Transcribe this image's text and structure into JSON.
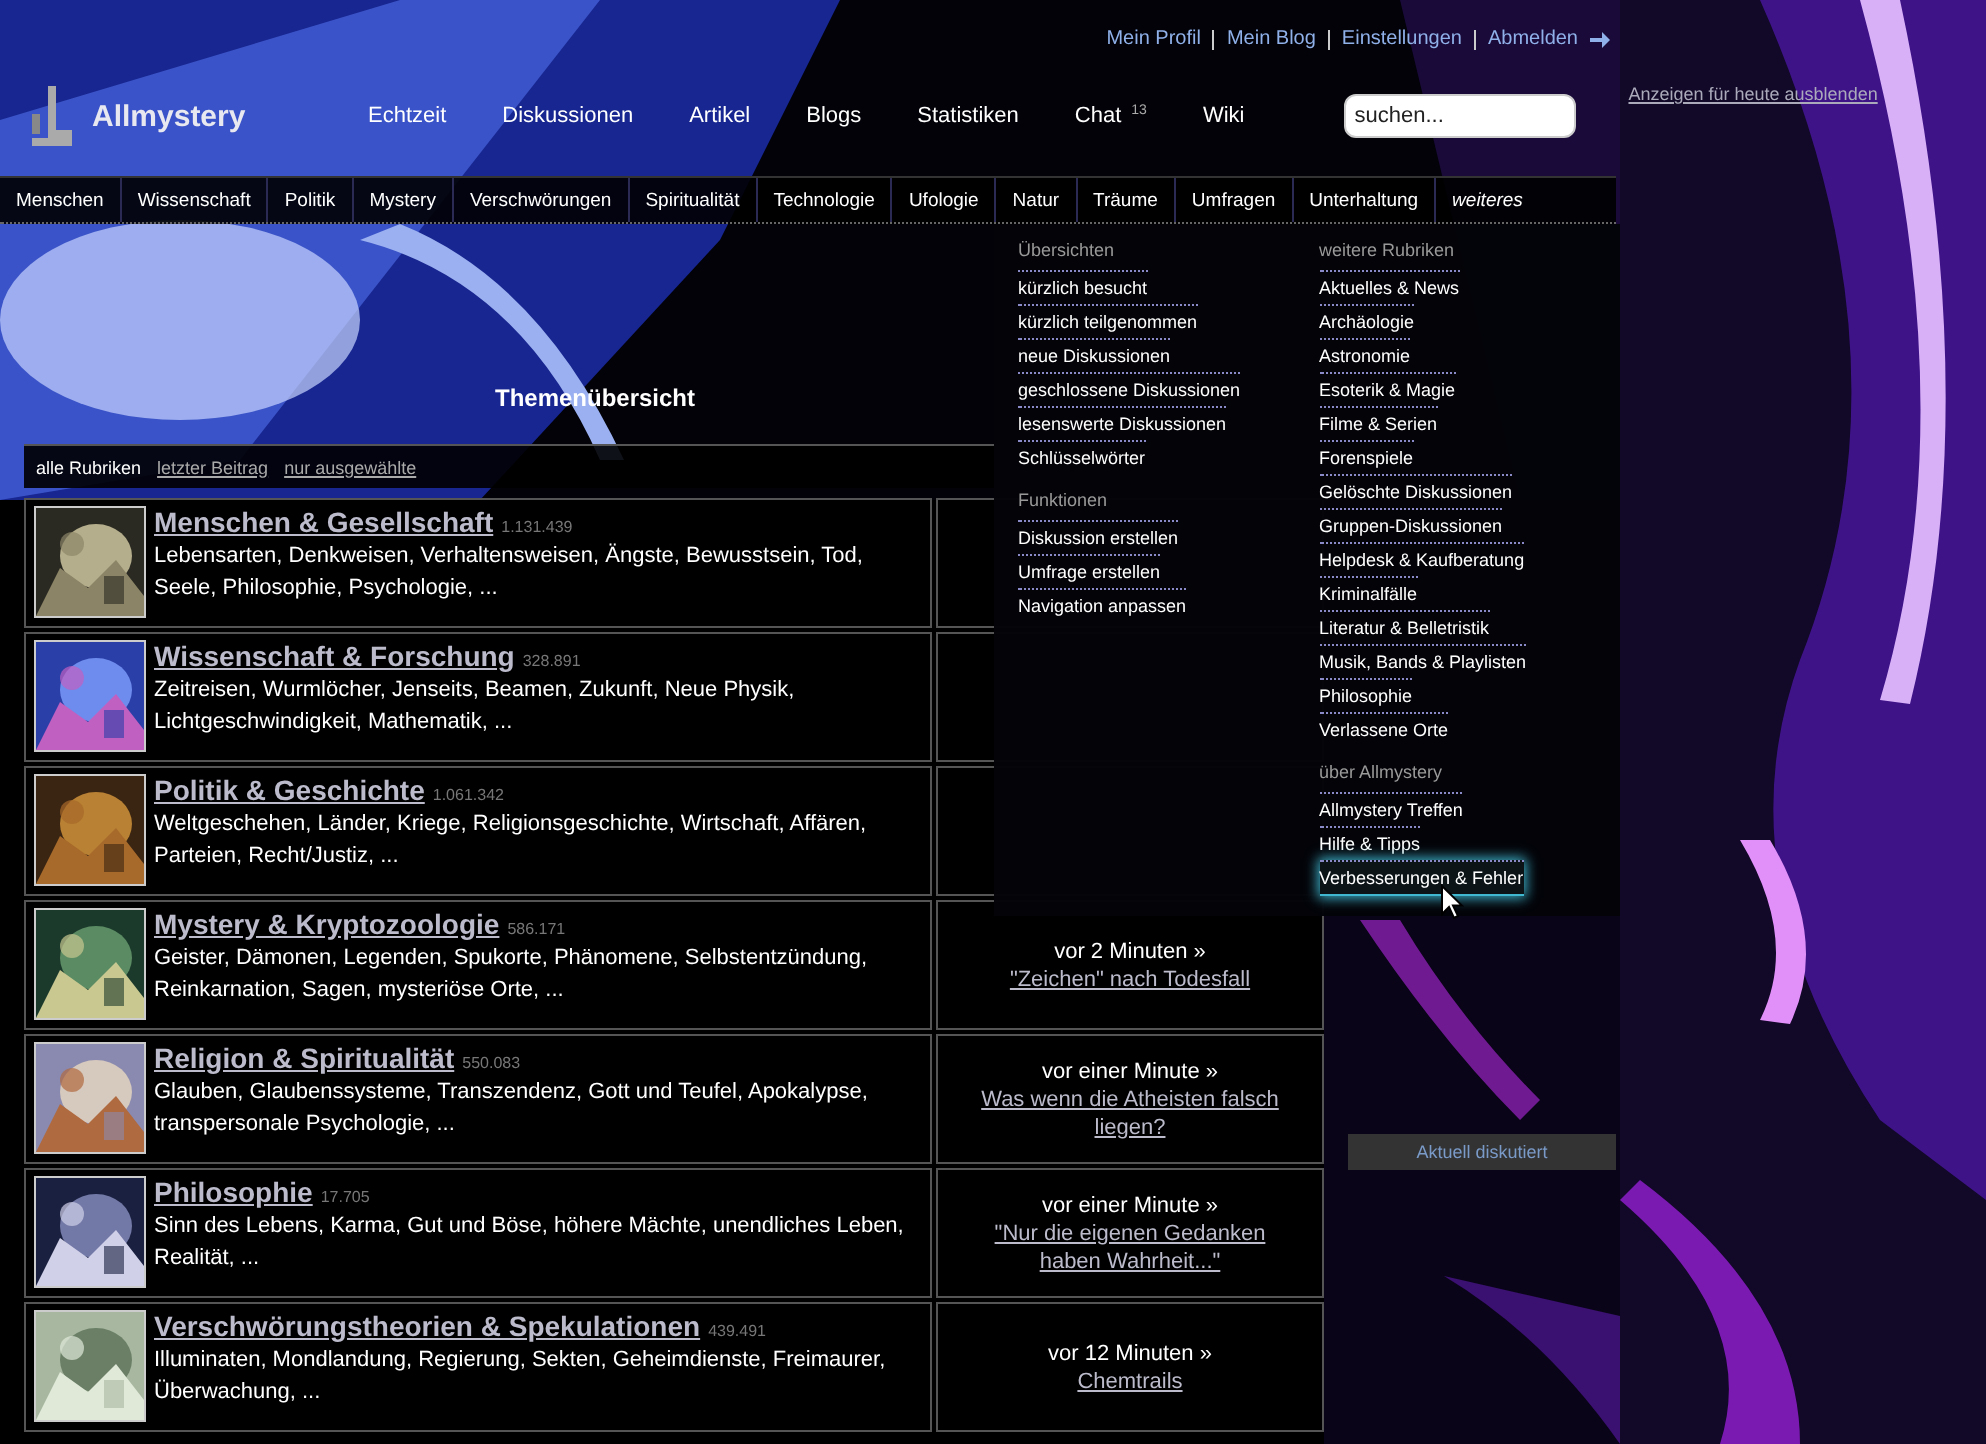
{
  "top_links": [
    "Mein Profil",
    "Mein Blog",
    "Einstellungen",
    "Abmelden"
  ],
  "logo": "Allmystery",
  "nav": [
    {
      "label": "Echtzeit"
    },
    {
      "label": "Diskussionen"
    },
    {
      "label": "Artikel"
    },
    {
      "label": "Blogs"
    },
    {
      "label": "Statistiken"
    },
    {
      "label": "Chat",
      "badge": "13"
    },
    {
      "label": "Wiki"
    }
  ],
  "search": {
    "placeholder": "suchen..."
  },
  "hide_ads_link": "Anzeigen für heute ausblenden",
  "categories": [
    {
      "label": "Menschen",
      "kind": "plain"
    },
    {
      "label": "Wissenschaft",
      "kind": "plain"
    },
    {
      "label": "Politik",
      "kind": "plain"
    },
    {
      "label": "Mystery",
      "kind": "plain"
    },
    {
      "label": "Verschwörungen",
      "kind": "plain"
    },
    {
      "label": "Spiritualität",
      "kind": "plain"
    },
    {
      "label": "Technologie",
      "kind": "plain"
    },
    {
      "label": "Ufologie",
      "kind": "plain"
    },
    {
      "label": "Natur",
      "kind": "plain"
    },
    {
      "label": "Träume",
      "kind": "plain"
    },
    {
      "label": "Umfragen",
      "kind": "plain"
    },
    {
      "label": "Unterhaltung",
      "kind": "plain"
    },
    {
      "label": "weiteres",
      "kind": "more"
    }
  ],
  "banner_title": "Themenübersicht",
  "filters": [
    {
      "label": "alle Rubriken",
      "selected": true
    },
    {
      "label": "letzter Beitrag",
      "selected": false
    },
    {
      "label": "nur ausgewählte",
      "selected": false
    }
  ],
  "topics": [
    {
      "title": "Menschen & Gesellschaft",
      "count": "1.131.439",
      "description": "Lebensarten, Denkweisen, Verhaltensweisen, Ängste, Bewusstsein, Tod, Seele, Philosophie, Psychologie, ..."
    },
    {
      "title": "Wissenschaft & Forschung",
      "count": "328.891",
      "description": "Zeitreisen, Wurmlöcher, Jenseits, Beamen, Zukunft, Neue Physik, Lichtgeschwindigkeit, Mathematik, ..."
    },
    {
      "title": "Politik & Geschichte",
      "count": "1.061.342",
      "description": "Weltgeschehen, Länder, Kriege, Religionsgeschichte, Wirtschaft, Affären, Parteien, Recht/Justiz, ..."
    },
    {
      "title": "Mystery & Kryptozoologie",
      "count": "586.171",
      "description": "Geister, Dämonen, Legenden, Spukorte, Phänomene, Selbstentzündung, Reinkarnation, Sagen, mysteriöse Orte, ...",
      "latest": {
        "time": "vor 2 Minuten »",
        "link": "\"Zeichen\" nach Todesfall"
      }
    },
    {
      "title": "Religion & Spiritualität",
      "count": "550.083",
      "description": "Glauben, Glaubenssysteme, Transzendenz, Gott und Teufel, Apokalypse, transpersonale Psychologie, ...",
      "latest": {
        "time": "vor einer Minute »",
        "link": "Was wenn die Atheisten falsch liegen?"
      }
    },
    {
      "title": "Philosophie",
      "count": "17.705",
      "description": "Sinn des Lebens, Karma, Gut und Böse, höhere Mächte, unendliches Leben, Realität, ...",
      "latest": {
        "time": "vor einer Minute »",
        "link": "\"Nur die eigenen Gedanken haben Wahrheit...\""
      }
    },
    {
      "title": "Verschwörungstheorien & Spekulationen",
      "count": "439.491",
      "description": "Illuminaten, Mondlandung, Regierung, Sekten, Geheimdienste, Freimaurer, Überwachung, ...",
      "latest": {
        "time": "vor 12 Minuten »",
        "link": "Chemtrails"
      }
    }
  ],
  "dropdown": {
    "columns": [
      [
        {
          "heading": "Übersichten",
          "items": [
            {
              "label": "kürzlich besucht",
              "highlighted": false
            },
            {
              "label": "kürzlich teilgenommen",
              "highlighted": false
            },
            {
              "label": "neue Diskussionen",
              "highlighted": false
            },
            {
              "label": "geschlossene Diskussionen",
              "highlighted": false
            },
            {
              "label": "lesenswerte Diskussionen",
              "highlighted": false
            },
            {
              "label": "Schlüsselwörter",
              "highlighted": false
            }
          ]
        },
        {
          "heading": "Funktionen",
          "items": [
            {
              "label": "Diskussion erstellen",
              "highlighted": false
            },
            {
              "label": "Umfrage erstellen",
              "highlighted": false
            },
            {
              "label": "Navigation anpassen",
              "highlighted": false
            }
          ]
        }
      ],
      [
        {
          "heading": "weitere Rubriken",
          "items": [
            {
              "label": "Aktuelles & News",
              "highlighted": false
            },
            {
              "label": "Archäologie",
              "highlighted": false
            },
            {
              "label": "Astronomie",
              "highlighted": false
            },
            {
              "label": "Esoterik & Magie",
              "highlighted": false
            },
            {
              "label": "Filme & Serien",
              "highlighted": false
            },
            {
              "label": "Forenspiele",
              "highlighted": false
            },
            {
              "label": "Gelöschte Diskussionen",
              "highlighted": false
            },
            {
              "label": "Gruppen-Diskussionen",
              "highlighted": false
            },
            {
              "label": "Helpdesk & Kaufberatung",
              "highlighted": false
            },
            {
              "label": "Kriminalfälle",
              "highlighted": false
            },
            {
              "label": "Literatur & Belletristik",
              "highlighted": false
            },
            {
              "label": "Musik, Bands & Playlisten",
              "highlighted": false
            },
            {
              "label": "Philosophie",
              "highlighted": false
            },
            {
              "label": "Verlassene Orte",
              "highlighted": false
            }
          ]
        },
        {
          "heading": "über Allmystery",
          "items": [
            {
              "label": "Allmystery Treffen",
              "highlighted": false
            },
            {
              "label": "Hilfe & Tipps",
              "highlighted": false
            },
            {
              "label": "Verbesserungen & Fehler",
              "highlighted": true
            }
          ]
        }
      ]
    ]
  },
  "aside_button": "Aktuell diskutiert"
}
